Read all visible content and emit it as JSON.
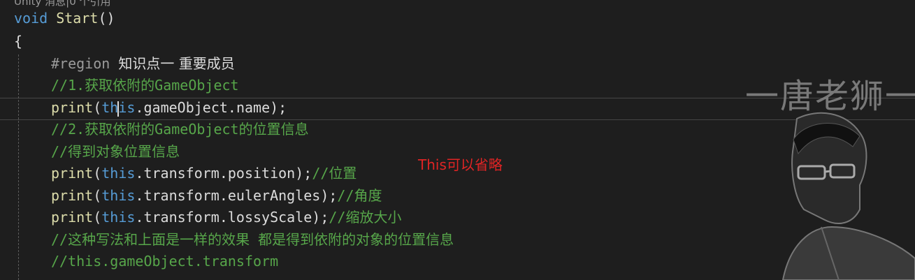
{
  "editor": {
    "codelens_hint": "Unity 消息|0 个引用",
    "lines": {
      "l1": {
        "kw": "void",
        "fn": "Start",
        "rest": "()"
      },
      "l2": {
        "text": "{"
      },
      "l3": {
        "directive": "#region",
        "label": "知识点一 重要成员"
      },
      "l4": {
        "comment": "//1.获取依附的GameObject"
      },
      "l5": {
        "fn": "print",
        "open": "(",
        "kw_a": "th",
        "kw_b": "is",
        "rest": ".gameObject.name);"
      },
      "l6": {
        "comment": "//2.获取依附的GameObject的位置信息"
      },
      "l7": {
        "comment": "//得到对象位置信息"
      },
      "l8": {
        "fn": "print",
        "open": "(",
        "kw": "this",
        "rest": ".transform.position);",
        "comment": "//位置"
      },
      "l9": {
        "fn": "print",
        "open": "(",
        "kw": "this",
        "rest": ".transform.eulerAngles);",
        "comment": "//角度"
      },
      "l10": {
        "fn": "print",
        "open": "(",
        "kw": "this",
        "rest": ".transform.lossyScale);",
        "comment": "//缩放大小"
      },
      "l11": {
        "comment": "//这种写法和上面是一样的效果 都是得到依附的对象的位置信息"
      },
      "l12": {
        "comment": "//this.gameObject.transform"
      }
    }
  },
  "annotation": {
    "text": "This可以省略",
    "color": "#e02424"
  },
  "watermark": {
    "text": "一唐老狮一"
  },
  "theme": {
    "background": "#1e1e1e",
    "keyword": "#569cd6",
    "method": "#dcdcaa",
    "comment": "#57a64a",
    "text": "#dcdcdc"
  }
}
